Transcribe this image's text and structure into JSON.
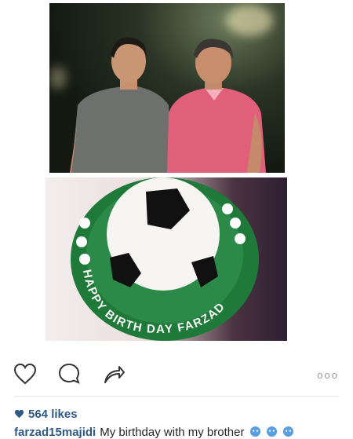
{
  "post": {
    "likes": "564 likes",
    "caption_user": "farzad15majidi",
    "caption_text": "My birthday with my brother",
    "cake_text": "HAPPY BIRTH DAY FARZAD",
    "more_glyph": "ooo"
  },
  "icons": {
    "like": "heart-outline-icon",
    "comment": "speech-bubble-icon",
    "share": "share-arrow-icon",
    "likes": "heart-filled-icon",
    "caption_emoji": "face-emoji-icon"
  },
  "colors": {
    "link": "#2f5a85",
    "cake_green": "#1f7a3a",
    "shirt_pink": "#e0607a",
    "shirt_grey": "#6d706c"
  }
}
